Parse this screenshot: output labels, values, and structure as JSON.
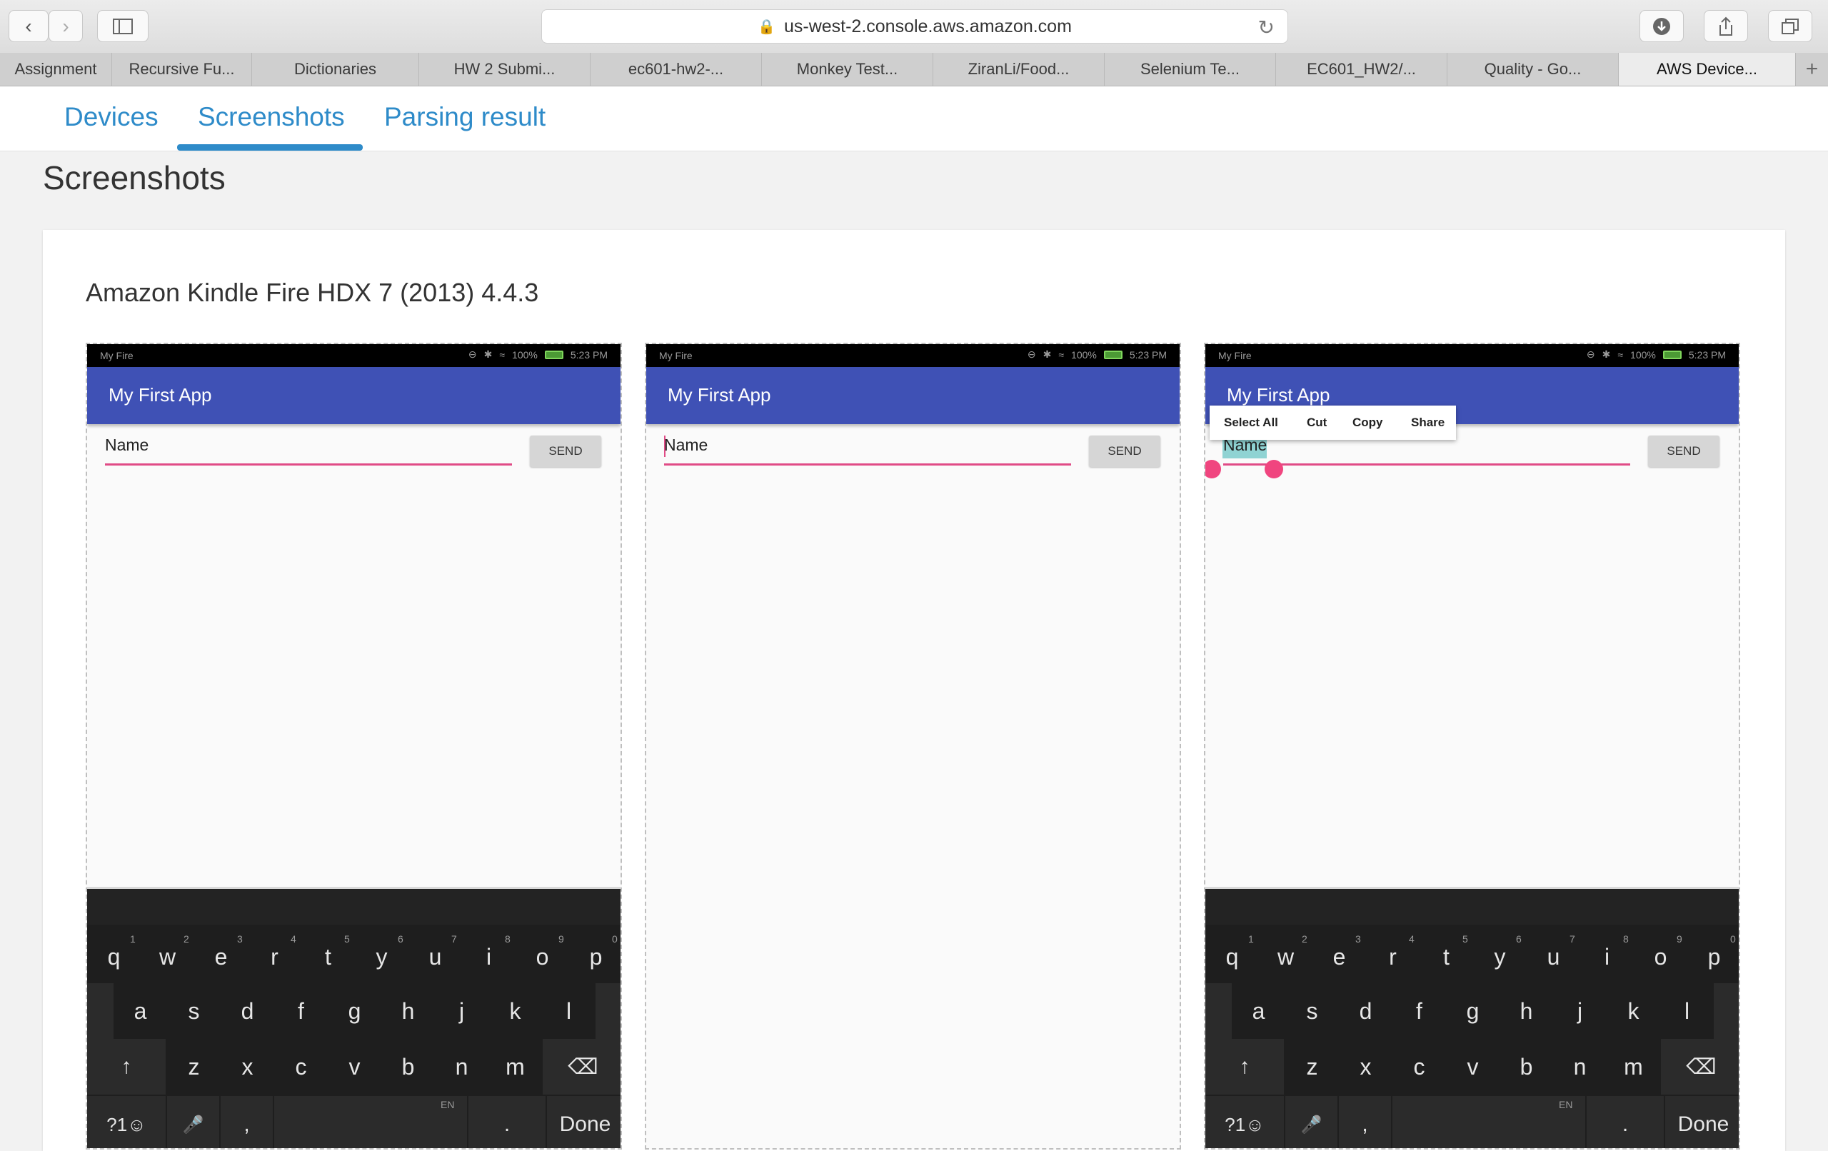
{
  "browser": {
    "url": "us-west-2.console.aws.amazon.com",
    "tabs": [
      "Assignment",
      "Recursive Fu...",
      "Dictionaries",
      "HW 2 Submi...",
      "ec601-hw2-...",
      "Monkey Test...",
      "ZiranLi/Food...",
      "Selenium Te...",
      "EC601_HW2/...",
      "Quality - Go...",
      "AWS Device..."
    ],
    "active_tab": 10,
    "icons": {
      "back": "chevron-left-icon",
      "forward": "chevron-right-icon",
      "sidebar": "sidebar-icon",
      "download": "download-icon",
      "share": "share-icon",
      "tabs": "tabs-icon",
      "reload": "reload-icon",
      "lock": "lock-icon",
      "new_tab": "plus-icon"
    }
  },
  "nav": {
    "tabs": [
      "Devices",
      "Screenshots",
      "Parsing result"
    ],
    "active": 1
  },
  "page": {
    "title": "Screenshots",
    "device": "Amazon Kindle Fire HDX 7 (2013) 4.4.3"
  },
  "screenshots": [
    {
      "status_carrier": "My Fire",
      "battery": "100%",
      "time": "5:23 PM",
      "app_title": "My First App",
      "field_text": "Name",
      "send_label": "SEND"
    },
    {
      "status_carrier": "My Fire",
      "battery": "100%",
      "time": "5:23 PM",
      "app_title": "My First App",
      "field_text": "Name",
      "send_label": "SEND"
    },
    {
      "status_carrier": "My Fire",
      "battery": "100%",
      "time": "5:23 PM",
      "app_title": "My First App",
      "field_text": "Name",
      "send_label": "SEND",
      "context_menu": [
        "Select All",
        "Cut",
        "Copy",
        "Share"
      ]
    }
  ],
  "keyboard": {
    "row1": [
      "q",
      "w",
      "e",
      "r",
      "t",
      "y",
      "u",
      "i",
      "o",
      "p"
    ],
    "row1_hints": [
      "1",
      "2",
      "3",
      "4",
      "5",
      "6",
      "7",
      "8",
      "9",
      "0"
    ],
    "row2": [
      "a",
      "s",
      "d",
      "f",
      "g",
      "h",
      "j",
      "k",
      "l"
    ],
    "row3": [
      "z",
      "x",
      "c",
      "v",
      "b",
      "n",
      "m"
    ],
    "shift": "↑",
    "backspace": "⌫",
    "symbols": "?1☺",
    "mic": "🎤",
    "comma": ",",
    "space_hint": "EN",
    "period": ".",
    "done": "Done",
    "accent": "#f0457f"
  },
  "colors": {
    "link": "#2e8bc9",
    "appbar": "#3f51b5",
    "selection": "#8fd3d3"
  }
}
